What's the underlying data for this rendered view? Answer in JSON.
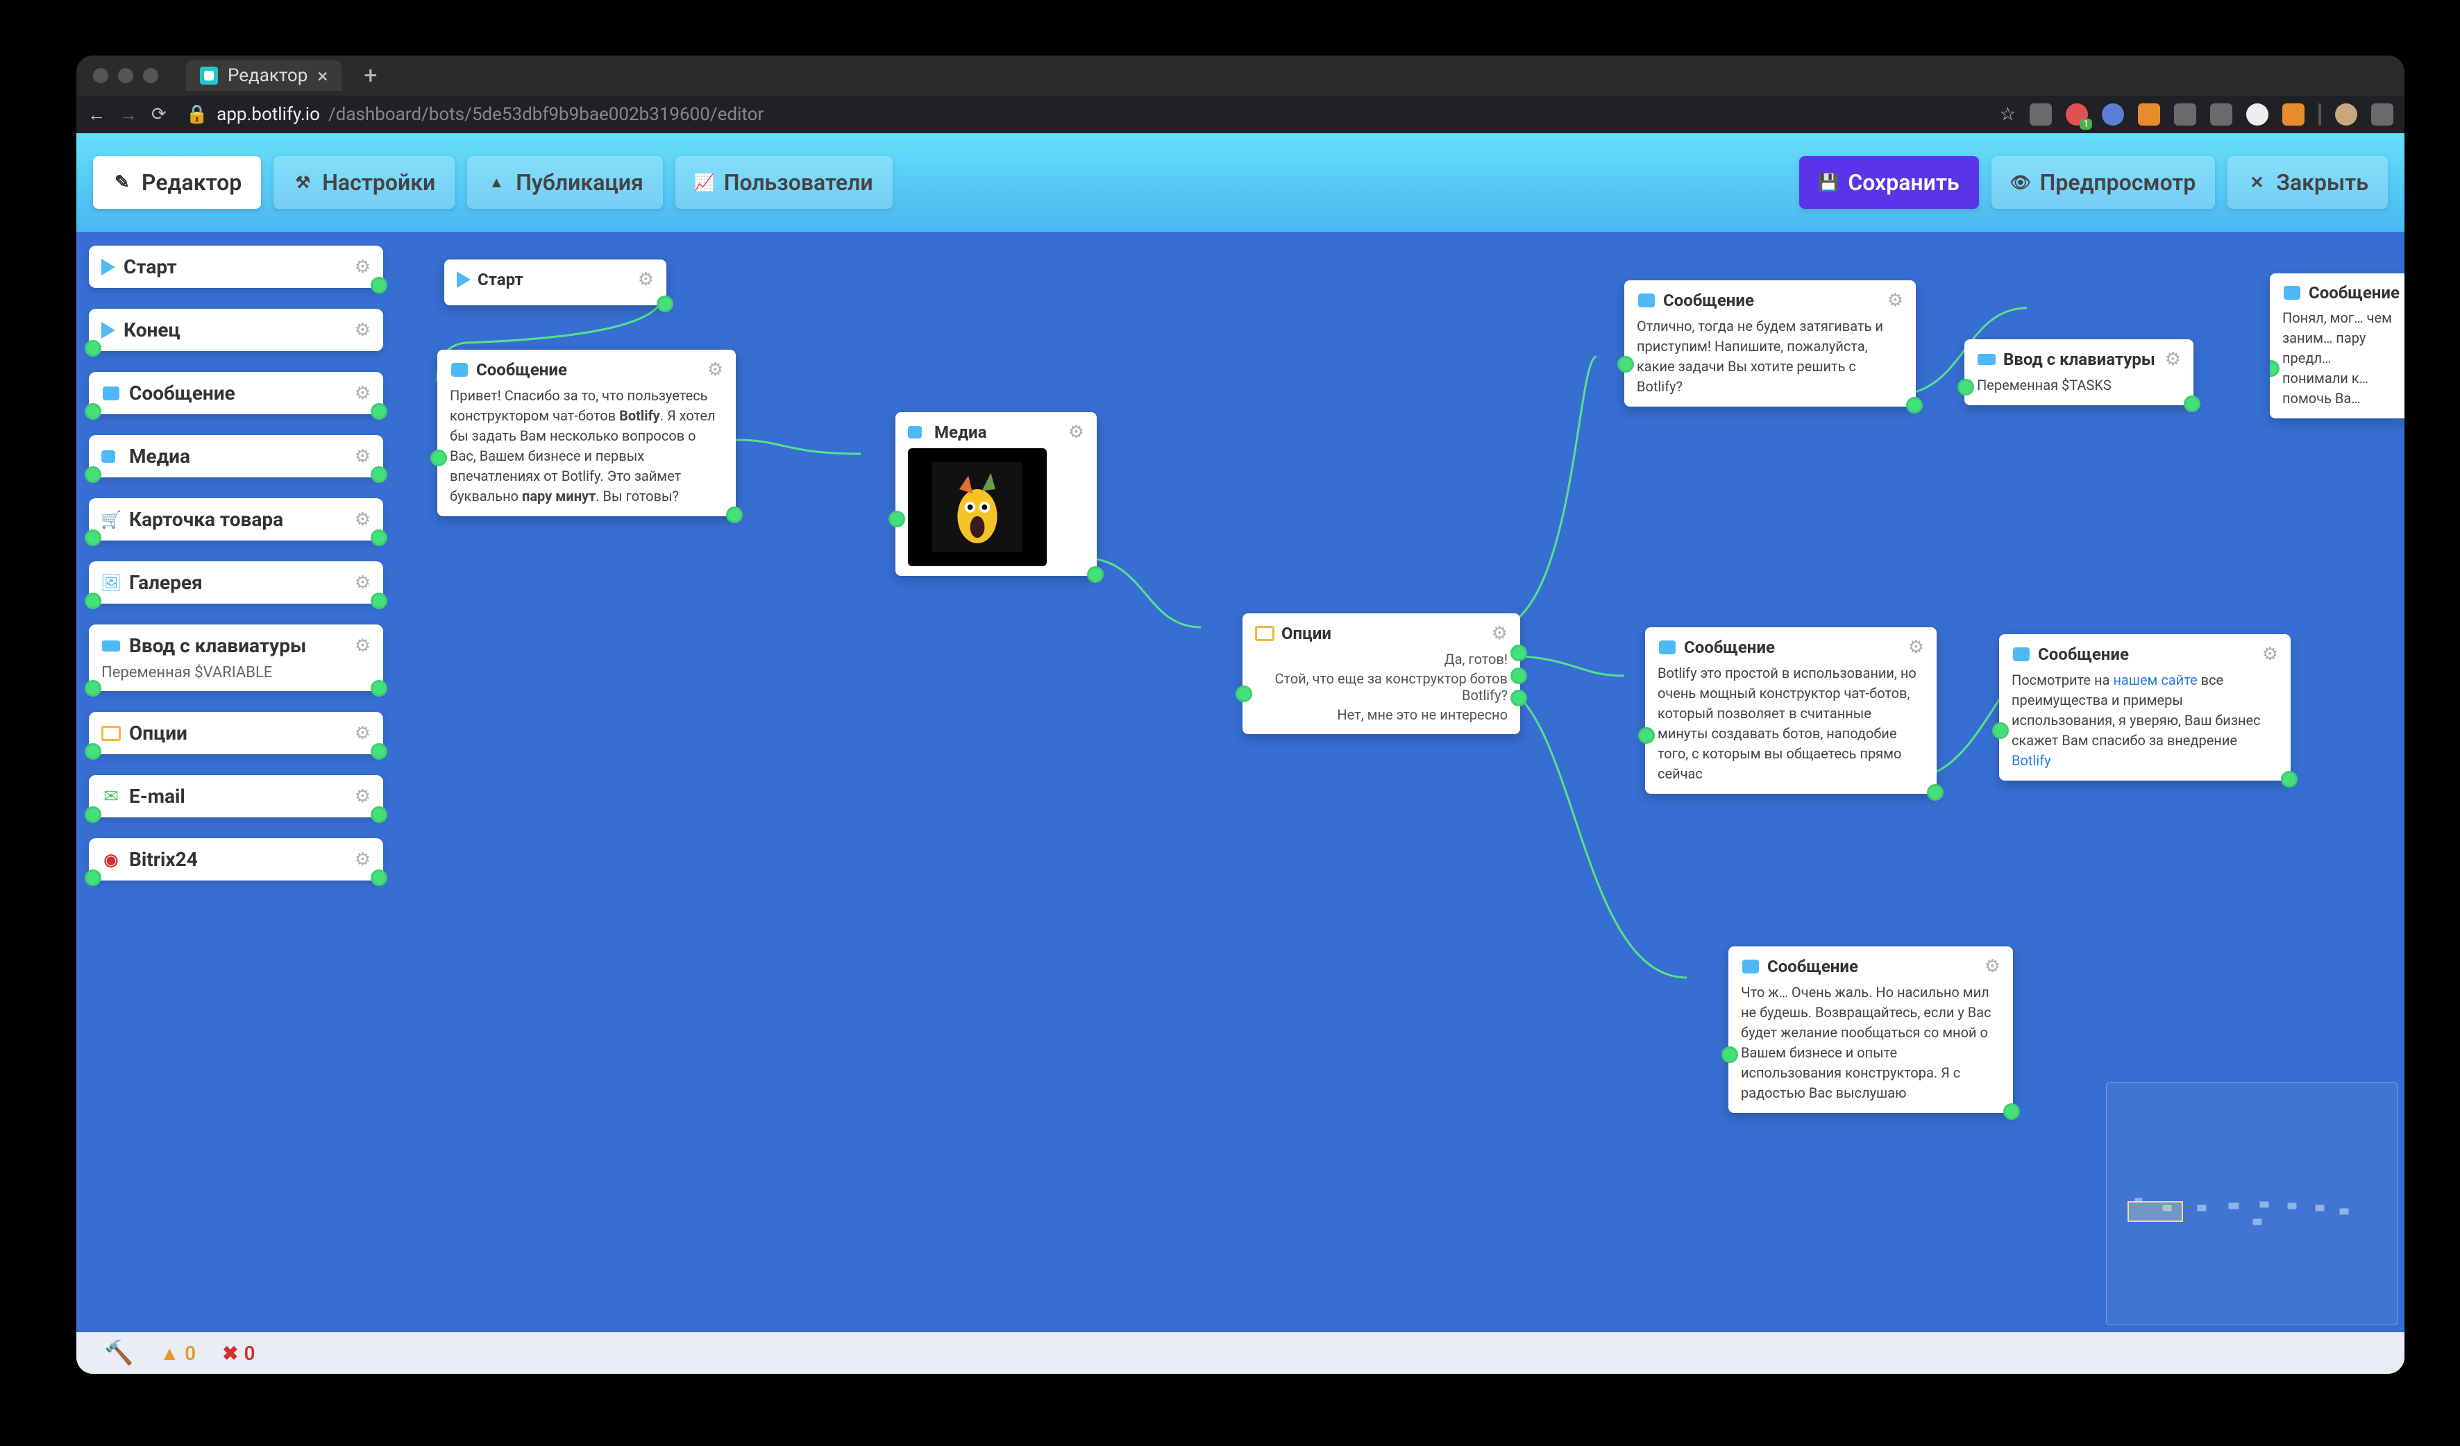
{
  "browser": {
    "tab_title": "Редактор",
    "url_host": "app.botlify.io",
    "url_path": "/dashboard/bots/5de53dbf9b9bae002b319600/editor"
  },
  "toolbar": {
    "editor": "Редактор",
    "settings": "Настройки",
    "publish": "Публикация",
    "users": "Пользователи",
    "save": "Сохранить",
    "preview": "Предпросмотр",
    "close": "Закрыть"
  },
  "sidebar": [
    {
      "icon": "play",
      "title": "Старт"
    },
    {
      "icon": "play",
      "title": "Конец"
    },
    {
      "icon": "chat",
      "title": "Сообщение"
    },
    {
      "icon": "cam",
      "title": "Медиа"
    },
    {
      "icon": "cart",
      "title": "Карточка товара"
    },
    {
      "icon": "gallery",
      "title": "Галерея"
    },
    {
      "icon": "key",
      "title": "Ввод с клавиатуры",
      "sub": "Переменная $VARIABLE"
    },
    {
      "icon": "opts",
      "title": "Опции"
    },
    {
      "icon": "mail",
      "title": "E-mail"
    },
    {
      "icon": "b24",
      "title": "Bitrix24"
    }
  ],
  "canvas": {
    "start": {
      "title": "Старт"
    },
    "msg1": {
      "title": "Сообщение",
      "body_pre": "Привет! Спасибо за то, что пользуетесь конструктором чат-ботов ",
      "body_bold": "Botlify",
      "body_mid": ". Я хотел бы задать Вам несколько вопросов о Вас, Вашем бизнесе и первых впечатлениях от Botlify. Это займет буквально ",
      "body_bold2": "пару минут",
      "body_post": ". Вы готовы?"
    },
    "media": {
      "title": "Медиа"
    },
    "options": {
      "title": "Опции",
      "o1": "Да, готов!",
      "o2": "Стой, что еще за конструктор ботов Botlify?",
      "o3": "Нет, мне это не интересно"
    },
    "msg2": {
      "title": "Сообщение",
      "body": "Отлично, тогда не будем затягивать и приступим! Напишите, пожалуйста, какие задачи Вы хотите решить с Botlify?"
    },
    "msg3": {
      "title": "Сообщение",
      "body": "Botlify это простой в использовании, но очень мощный конструктор чат-ботов, который позволяет в считанные минуты создавать ботов, наподобие того, с которым вы общаетесь прямо сейчас"
    },
    "msg4": {
      "title": "Сообщение",
      "body_pre": "Посмотрите на ",
      "link": "нашем сайте",
      "body_post": " все преимущества и примеры использования, я уверяю, Ваш бизнес скажет Вам спасибо за внедрение ",
      "link2": "Botlify"
    },
    "msg5": {
      "title": "Сообщение",
      "body": "Что ж… Очень жаль. Но насильно мил не будешь. Возвращайтесь, если у Вас будет желание пообщаться со мной о Вашем бизнесе и опыте использования конструктора. Я с радостью Вас выслушаю"
    },
    "input1": {
      "title": "Ввод с клавиатуры",
      "sub": "Переменная $TASKS"
    },
    "msg6": {
      "title": "Сообщение",
      "body": "Понял, мог… чем заним… пару предл… понимали к… помочь Ва…"
    }
  },
  "status": {
    "warnings": "0",
    "errors": "0"
  }
}
